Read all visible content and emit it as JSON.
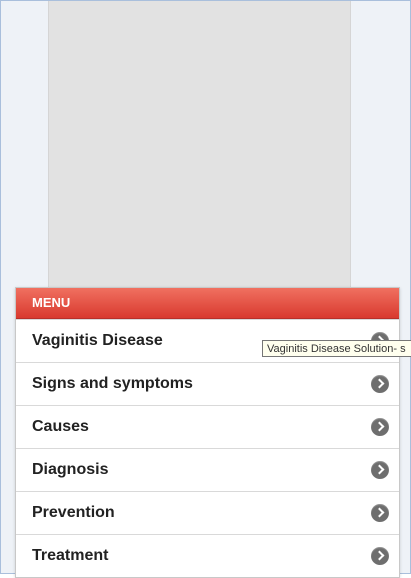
{
  "menu": {
    "header": "MENU",
    "items": [
      {
        "label": "Vaginitis Disease",
        "icon": "chevron-right-icon"
      },
      {
        "label": "Signs and symptoms",
        "icon": "chevron-right-icon"
      },
      {
        "label": "Causes",
        "icon": "chevron-right-icon"
      },
      {
        "label": "Diagnosis",
        "icon": "chevron-right-icon"
      },
      {
        "label": "Prevention",
        "icon": "chevron-right-icon"
      },
      {
        "label": "Treatment",
        "icon": "chevron-right-icon"
      }
    ]
  },
  "tooltip": {
    "text": "Vaginitis Disease Solution- s"
  },
  "colors": {
    "header_bg": "#e0483a",
    "frame_border": "#a9bfdc"
  }
}
